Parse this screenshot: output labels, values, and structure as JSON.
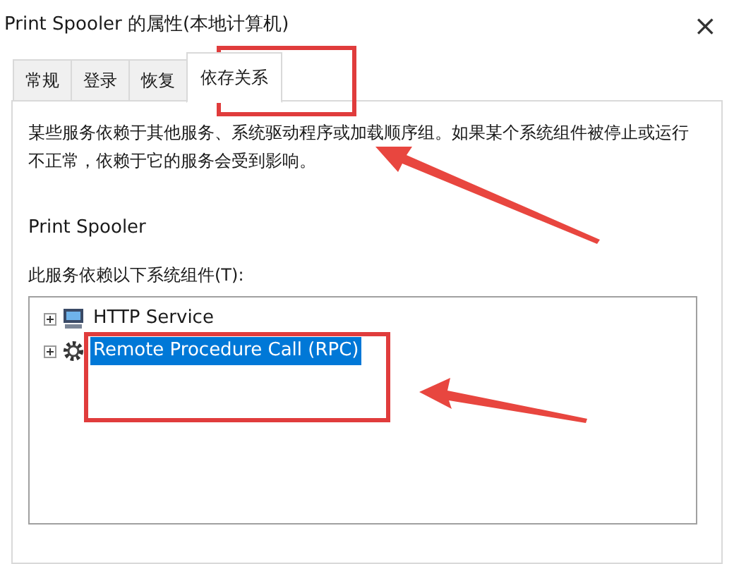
{
  "window": {
    "title": "Print Spooler 的属性(本地计算机)",
    "close": "×"
  },
  "tabs": [
    {
      "label": "常规",
      "selected": false
    },
    {
      "label": "登录",
      "selected": false
    },
    {
      "label": "恢复",
      "selected": false
    },
    {
      "label": "依存关系",
      "selected": true
    }
  ],
  "description": "某些服务依赖于其他服务、系统驱动程序或加载顺序组。如果某个系统组件被停止或运行不正常，依赖于它的服务会受到影响。",
  "service_name": "Print Spooler",
  "dependencies_label": "此服务依赖以下系统组件(T):",
  "tree": [
    {
      "label": "HTTP Service",
      "kind": "computer",
      "expanded": false,
      "selected": false
    },
    {
      "label": "Remote Procedure Call (RPC)",
      "kind": "gear",
      "expanded": false,
      "selected": true
    }
  ]
}
